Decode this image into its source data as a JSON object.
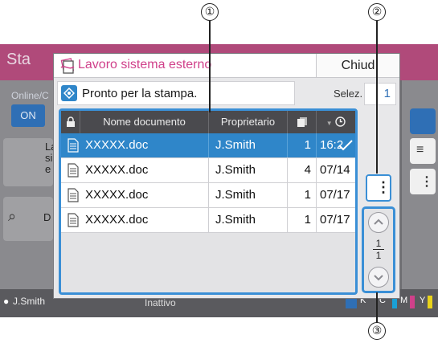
{
  "callouts": [
    "①",
    "②",
    "③"
  ],
  "background": {
    "title": "Sta",
    "online_label": "Online/C",
    "on_button": "ON",
    "row1_text": "La si e",
    "row2_text": "D",
    "user": "J.Smith",
    "status": "Inattivo",
    "color_labels": [
      "K",
      "C",
      "M",
      "Y"
    ]
  },
  "dialog": {
    "title": "Lavoro sistema esterno",
    "close_label": "Chiud",
    "status_text": "Pronto per la stampa.",
    "selez_label": "Selez.",
    "selez_value": "1"
  },
  "table": {
    "headers": [
      "Nome documento",
      "Proprietario"
    ],
    "rows": [
      {
        "name": "XXXXX.doc",
        "owner": "J.Smith",
        "copies": "1",
        "time": "16:2",
        "selected": true
      },
      {
        "name": "XXXXX.doc",
        "owner": "J.Smith",
        "copies": "4",
        "time": "07/14",
        "selected": false
      },
      {
        "name": "XXXXX.doc",
        "owner": "J.Smith",
        "copies": "1",
        "time": "07/17",
        "selected": false
      },
      {
        "name": "XXXXX.doc",
        "owner": "J.Smith",
        "copies": "1",
        "time": "07/17",
        "selected": false
      }
    ]
  },
  "pager": {
    "current": "1",
    "total": "1"
  },
  "colors": {
    "accent_blue": "#3a8fd6",
    "selected_row": "#2f86c9",
    "title_pink": "#d0408a"
  }
}
